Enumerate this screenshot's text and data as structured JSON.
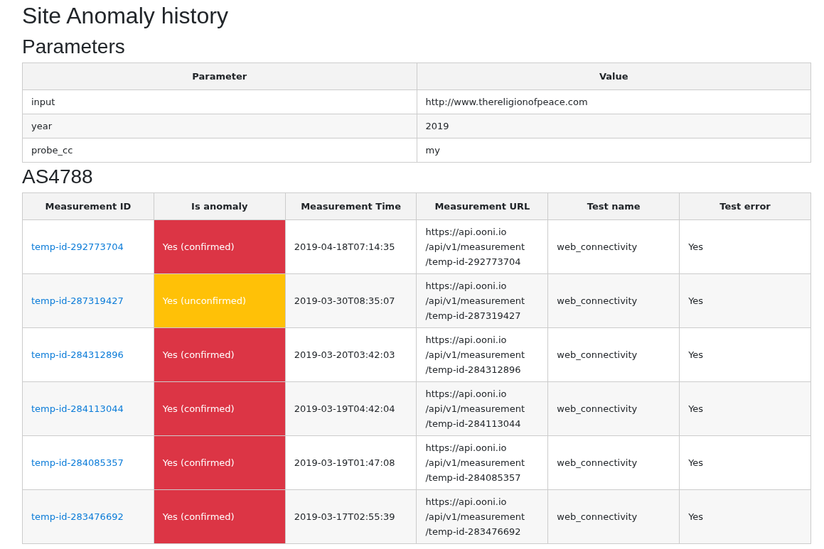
{
  "title": "Site Anomaly history",
  "parameters": {
    "heading": "Parameters",
    "columns": [
      "Parameter",
      "Value"
    ],
    "rows": [
      [
        "input",
        "http://www.thereligionofpeace.com"
      ],
      [
        "year",
        "2019"
      ],
      [
        "probe_cc",
        "my"
      ]
    ]
  },
  "network": {
    "heading": "AS4788",
    "columns": [
      "Measurement ID",
      "Is anomaly",
      "Measurement Time",
      "Measurement URL",
      "Test name",
      "Test error"
    ],
    "rows": [
      {
        "id": "temp-id-292773704",
        "anomaly": {
          "text": "Yes (confirmed)",
          "color": "#dc3545"
        },
        "time": "2019-04-18T07:14:35",
        "url_lines": [
          "https://api.ooni.io",
          "/api/v1/measurement",
          "/temp-id-292773704"
        ],
        "test_name": "web_connectivity",
        "test_error": "Yes"
      },
      {
        "id": "temp-id-287319427",
        "anomaly": {
          "text": "Yes (unconfirmed)",
          "color": "#ffc107"
        },
        "time": "2019-03-30T08:35:07",
        "url_lines": [
          "https://api.ooni.io",
          "/api/v1/measurement",
          "/temp-id-287319427"
        ],
        "test_name": "web_connectivity",
        "test_error": "Yes"
      },
      {
        "id": "temp-id-284312896",
        "anomaly": {
          "text": "Yes (confirmed)",
          "color": "#dc3545"
        },
        "time": "2019-03-20T03:42:03",
        "url_lines": [
          "https://api.ooni.io",
          "/api/v1/measurement",
          "/temp-id-284312896"
        ],
        "test_name": "web_connectivity",
        "test_error": "Yes"
      },
      {
        "id": "temp-id-284113044",
        "anomaly": {
          "text": "Yes (confirmed)",
          "color": "#dc3545"
        },
        "time": "2019-03-19T04:42:04",
        "url_lines": [
          "https://api.ooni.io",
          "/api/v1/measurement",
          "/temp-id-284113044"
        ],
        "test_name": "web_connectivity",
        "test_error": "Yes"
      },
      {
        "id": "temp-id-284085357",
        "anomaly": {
          "text": "Yes (confirmed)",
          "color": "#dc3545"
        },
        "time": "2019-03-19T01:47:08",
        "url_lines": [
          "https://api.ooni.io",
          "/api/v1/measurement",
          "/temp-id-284085357"
        ],
        "test_name": "web_connectivity",
        "test_error": "Yes"
      },
      {
        "id": "temp-id-283476692",
        "anomaly": {
          "text": "Yes (confirmed)",
          "color": "#dc3545"
        },
        "time": "2019-03-17T02:55:39",
        "url_lines": [
          "https://api.ooni.io",
          "/api/v1/measurement",
          "/temp-id-283476692"
        ],
        "test_name": "web_connectivity",
        "test_error": "Yes"
      }
    ]
  }
}
